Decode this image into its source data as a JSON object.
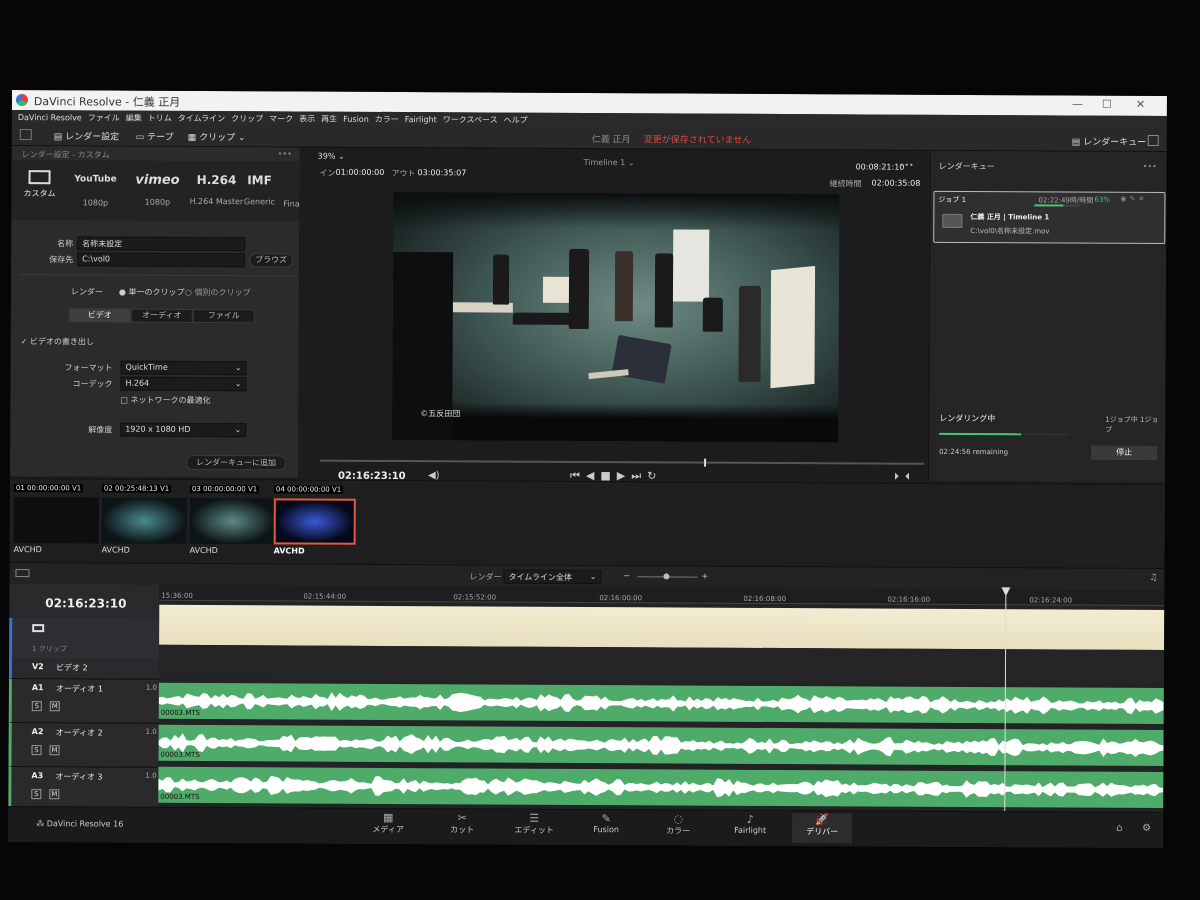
{
  "titlebar": {
    "app": "DaVinci Resolve",
    "project": "仁義 正月"
  },
  "menu": [
    "DaVinci Resolve",
    "ファイル",
    "編集",
    "トリム",
    "タイムライン",
    "クリップ",
    "マーク",
    "表示",
    "再生",
    "Fusion",
    "カラー",
    "Fairlight",
    "ワークスペース",
    "ヘルプ"
  ],
  "toolbar": {
    "render_settings": "レンダー設定",
    "tape": "テープ",
    "clip": "クリップ",
    "project_name": "仁義 正月",
    "unsaved": "変更が保存されていません",
    "render_queue": "レンダーキュー"
  },
  "left": {
    "header": "レンダー設定 - カスタム",
    "presets": [
      {
        "name": "カスタム",
        "sub": ""
      },
      {
        "name": "YouTube",
        "sub": "1080p"
      },
      {
        "name": "vimeo",
        "sub": "1080p"
      },
      {
        "name": "H.264",
        "sub": "H.264 Master"
      },
      {
        "name": "IMF",
        "sub": "Generic"
      },
      {
        "name": "",
        "sub": "Fina"
      }
    ],
    "name_label": "名称",
    "name_value": "名称未設定",
    "loc_label": "保存先",
    "loc_value": "C:\\vol0",
    "browse": "ブラウズ",
    "render_label": "レンダー",
    "single": "単一のクリップ",
    "individual": "個別のクリップ",
    "tabs": [
      "ビデオ",
      "オーディオ",
      "ファイル"
    ],
    "export_video": "ビデオの書き出し",
    "format_label": "フォーマット",
    "format": "QuickTime",
    "codec_label": "コーデック",
    "codec": "H.264",
    "network": "ネットワークの最適化",
    "res_label": "解像度",
    "res": "1920 x 1080 HD",
    "add": "レンダーキューに追加"
  },
  "viewer": {
    "zoom": "39%",
    "timeline": "Timeline 1",
    "in_label": "イン",
    "in_tc": "01:00:00:00",
    "out_label": "アウト",
    "out_tc": "03:00:35:07",
    "dur_tc": "00:08:21:10",
    "total_label": "継続時間",
    "total_tc": "02:00:35:08",
    "tc": "02:16:23:10",
    "watermark": "©五反田団"
  },
  "queue": {
    "job": "ジョブ 1",
    "job_time": "02:22:49時/時間",
    "pct": "63%",
    "job_title": "仁義 正月 | Timeline 1",
    "job_path": "C:\\vol0\\名称未設定.mov",
    "status": "レンダリング中",
    "count": "1ジョブ中 1ジョブ",
    "remaining": "02:24:56 remaining",
    "stop": "停止",
    "progress": 0.63
  },
  "clips": [
    {
      "n": "01",
      "tc": "00:00:00:00",
      "tr": "V1",
      "codec": "AVCHD"
    },
    {
      "n": "02",
      "tc": "00:25:48:13",
      "tr": "V1",
      "codec": "AVCHD"
    },
    {
      "n": "03",
      "tc": "00:00:00:00",
      "tr": "V1",
      "codec": "AVCHD"
    },
    {
      "n": "04",
      "tc": "00:00:00:00",
      "tr": "V1",
      "codec": "AVCHD"
    }
  ],
  "timeline": {
    "render_label": "レンダー",
    "render_value": "タイムライン全体",
    "tc": "02:16:23:10",
    "ruler": [
      "15:36:00",
      "02:15:44:00",
      "02:15:52:00",
      "02:16:00:00",
      "02:16:08:00",
      "02:16:16:00",
      "02:16:24:00"
    ],
    "clips_count": "1 クリップ",
    "v2": "V2",
    "v2_name": "ビデオ 2",
    "tracks": [
      {
        "id": "A1",
        "name": "オーディオ 1",
        "level": "1.0",
        "clip": "00003.MTS"
      },
      {
        "id": "A2",
        "name": "オーディオ 2",
        "level": "1.0",
        "clip": "00003.MTS"
      },
      {
        "id": "A3",
        "name": "オーディオ 3",
        "level": "1.0",
        "clip": "00003.MTS"
      }
    ],
    "s": "S",
    "m": "M"
  },
  "pages": {
    "brand": "DaVinci Resolve 16",
    "items": [
      "メディア",
      "カット",
      "エディット",
      "Fusion",
      "カラー",
      "Fairlight",
      "デリバー"
    ]
  }
}
